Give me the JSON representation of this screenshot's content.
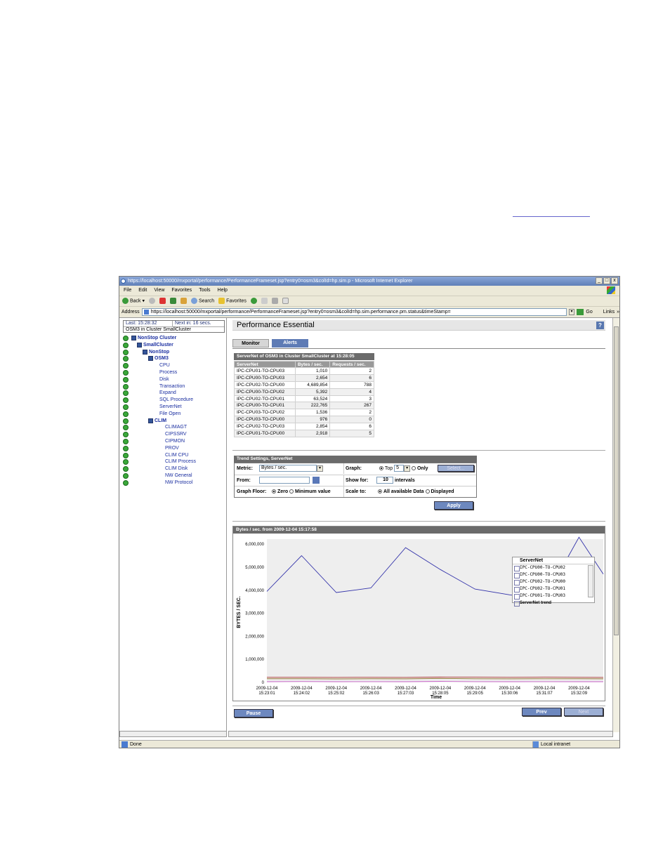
{
  "window": {
    "title": "https://localhost:50000/mxportal/performance/PerformanceFrameset.jsp?entry0=osm3&colId=hp.sim.p - Microsoft Internet Explorer",
    "controls": [
      "_",
      "□",
      "x"
    ]
  },
  "menu": [
    "File",
    "Edit",
    "View",
    "Favorites",
    "Tools",
    "Help"
  ],
  "toolbar": {
    "back": "Back",
    "search": "Search",
    "favorites": "Favorites"
  },
  "address": {
    "label": "Address",
    "url": "https://localhost:50000/mxportal/performance/PerformanceFrameset.jsp?entry0=osm3&colId=hp.sim.performance.pm.status&timeStamp=",
    "go": "Go",
    "links": "Links"
  },
  "left": {
    "last": "Last: 15:28:32",
    "next": "Next in: 16 secs.",
    "context": "OSM3 in Cluster SmallCluster",
    "tree": [
      {
        "label": "NonStop Cluster",
        "level": 0,
        "box": true,
        "bold": true
      },
      {
        "label": "SmallCluster",
        "level": 1,
        "box": true,
        "bold": true
      },
      {
        "label": "NonStop",
        "level": 2,
        "box": true,
        "bold": true
      },
      {
        "label": "OSM3",
        "level": 3,
        "box": true,
        "bold": true
      },
      {
        "label": "CPU",
        "level": 4
      },
      {
        "label": "Process",
        "level": 4
      },
      {
        "label": "Disk",
        "level": 4
      },
      {
        "label": "Transaction",
        "level": 4
      },
      {
        "label": "Expand",
        "level": 4
      },
      {
        "label": "SQL Procedure",
        "level": 4
      },
      {
        "label": "ServerNet",
        "level": 4
      },
      {
        "label": "File Open",
        "level": 4
      },
      {
        "label": "CLIM",
        "level": 3,
        "box": true,
        "bold": true
      },
      {
        "label": "CLIMAGT",
        "level": 5
      },
      {
        "label": "CIPSSRV",
        "level": 5
      },
      {
        "label": "CIPMON",
        "level": 5
      },
      {
        "label": "PROV",
        "level": 5
      },
      {
        "label": "CLIM CPU",
        "level": 5
      },
      {
        "label": "CLIM Process",
        "level": 5
      },
      {
        "label": "CLIM Disk",
        "level": 5
      },
      {
        "label": "NW General",
        "level": 5
      },
      {
        "label": "NW Protocol",
        "level": 5
      }
    ]
  },
  "main": {
    "title": "Performance Essential",
    "help": "?",
    "tabs": [
      "Monitor",
      "Alerts"
    ],
    "servernet_caption": "ServerNet of OSM3 in Cluster SmallCluster at 15:28:05",
    "table_headers": [
      "ServerNet",
      "Bytes / sec.",
      "Requests / sec."
    ],
    "table_rows": [
      [
        "IPC-CPU01-TO-CPU03",
        "1,010",
        "2"
      ],
      [
        "IPC-CPU00-TO-CPU03",
        "2,654",
        "6"
      ],
      [
        "IPC-CPU02-TO-CPU00",
        "4,689,854",
        "788"
      ],
      [
        "IPC-CPU00-TO-CPU02",
        "5,392",
        "4"
      ],
      [
        "IPC-CPU02-TO-CPU01",
        "63,524",
        "3"
      ],
      [
        "IPC-CPU00-TO-CPU01",
        "222,765",
        "267"
      ],
      [
        "IPC-CPU03-TO-CPU02",
        "1,536",
        "2"
      ],
      [
        "IPC-CPU03-TO-CPU00",
        "976",
        "0"
      ],
      [
        "IPC-CPU02-TO-CPU03",
        "2,854",
        "6"
      ],
      [
        "IPC-CPU01-TO-CPU00",
        "2,918",
        "5"
      ]
    ],
    "trend": {
      "caption": "Trend Settings, ServerNet",
      "metric_label": "Metric:",
      "metric_value": "Bytes / sec.",
      "graph_label": "Graph:",
      "top_label": "Top",
      "top_value": "5",
      "only_label": "Only",
      "select_button": "Select...",
      "from_label": "From:",
      "show_for_label": "Show for:",
      "show_for_value": "10",
      "intervals_label": "intervals",
      "floor_label": "Graph Floor:",
      "zero_label": "Zero",
      "minimum_label": "Minimum value",
      "scale_label": "Scale to:",
      "all_label": "All available Data",
      "displayed_label": "Displayed"
    },
    "apply": "Apply",
    "pause": "Pause",
    "prev": "Prev",
    "next": "Next"
  },
  "chart_data": {
    "type": "line",
    "title": "Bytes / sec. from 2009-12-04 15:17:58",
    "xlabel": "Time",
    "ylabel": "BYTES / SEC.",
    "ylim": [
      0,
      6000000
    ],
    "yticks": [
      "6,000,000",
      "5,000,000",
      "4,000,000",
      "3,000,000",
      "2,000,000",
      "1,000,000",
      "0"
    ],
    "x_dates": [
      "2009-12-04",
      "2009-12-04",
      "2009-12-04",
      "2009-12-04",
      "2009-12-04",
      "2009-12-04",
      "2009-12-04",
      "2009-12-04",
      "2009-12-04",
      "2009-12-04"
    ],
    "x_times": [
      "15:23:01",
      "15:24:02",
      "15:25:02",
      "15:26:03",
      "15:27:03",
      "15:28:05",
      "15:29:05",
      "15:30:06",
      "15:31:07",
      "15:32:09"
    ],
    "x": [
      0,
      1,
      2,
      3,
      4,
      5,
      6,
      7,
      8,
      9,
      10
    ],
    "series": [
      {
        "color": "#3333aa",
        "values": [
          3950000,
          5500000,
          3900000,
          4100000,
          5850000,
          4900000,
          4050000,
          3800000,
          3600000,
          6300000,
          4700000
        ]
      },
      {
        "color": "#aa3333",
        "values": [
          220000,
          220000,
          215000,
          220000,
          215000,
          230000,
          225000,
          220000,
          225000,
          220000,
          215000
        ]
      },
      {
        "color": "#8a6a20",
        "values": [
          160000,
          160000,
          150000,
          160000,
          155000,
          170000,
          160000,
          155000,
          160000,
          160000,
          155000
        ]
      },
      {
        "color": "#cc66cc",
        "values": [
          30000,
          40000,
          30000,
          35000,
          30000,
          45000,
          35000,
          30000,
          35000,
          30000,
          30000
        ]
      }
    ],
    "legend": {
      "title": "ServerNet",
      "items": [
        "IPC-CPU00-TO-CPU02",
        "IPC-CPU00-TO-CPU03",
        "IPC-CPU02-TO-CPU00",
        "IPC-CPU02-TO-CPU01",
        "IPC-CPU01-TO-CPU03"
      ],
      "footer": "ServerNet trend"
    }
  },
  "status": {
    "left": "Done",
    "right": "Local intranet"
  }
}
